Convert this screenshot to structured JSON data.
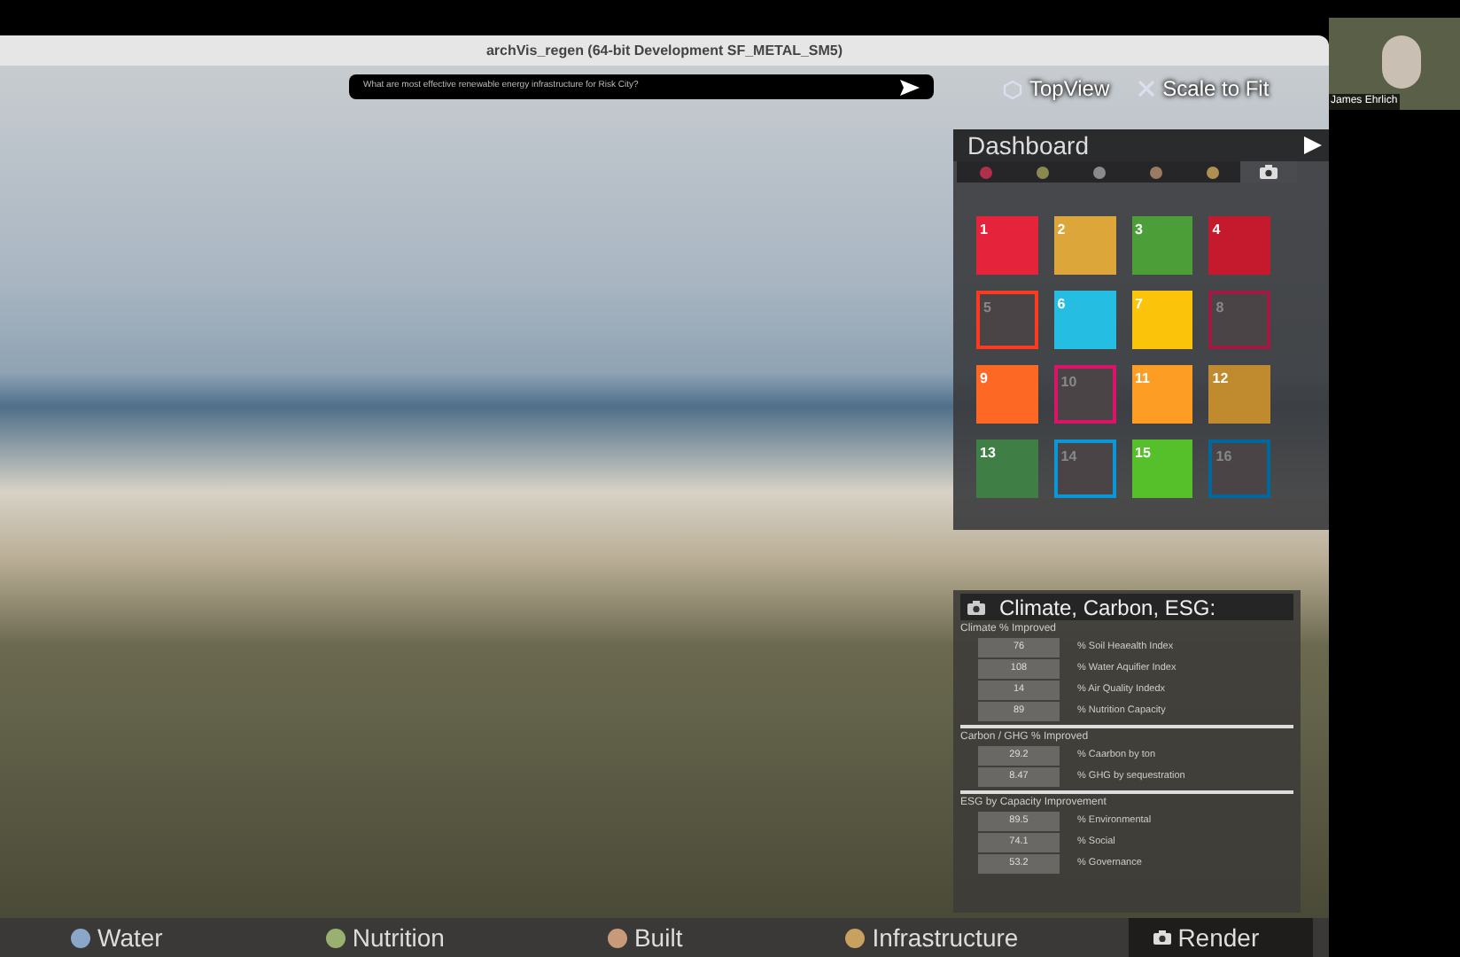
{
  "window": {
    "title": "archVis_regen (64-bit Development SF_METAL_SM5)"
  },
  "prompt": {
    "value": "What are most effective renewable energy infrastructure for Risk City?"
  },
  "view_buttons": [
    {
      "label": "TopView"
    },
    {
      "label": "Scale to Fit"
    }
  ],
  "dashboard": {
    "title": "Dashboard",
    "tabs": [
      {
        "color": "#b0304a",
        "selected": false
      },
      {
        "color": "#8a8a50",
        "selected": false
      },
      {
        "color": "#8a8a8a",
        "selected": false
      },
      {
        "color": "#9a7a60",
        "selected": false
      },
      {
        "color": "#b09050",
        "selected": false
      },
      {
        "color": "#dddddd",
        "selected": true
      }
    ],
    "goals": [
      {
        "number": "1",
        "color": "#e5243b",
        "active": true
      },
      {
        "number": "2",
        "color": "#dda63a",
        "active": true
      },
      {
        "number": "3",
        "color": "#4c9f38",
        "active": true
      },
      {
        "number": "4",
        "color": "#c5192d",
        "active": true
      },
      {
        "number": "5",
        "color": "#ff3a21",
        "active": false
      },
      {
        "number": "6",
        "color": "#26bde2",
        "active": true
      },
      {
        "number": "7",
        "color": "#fcc30b",
        "active": true
      },
      {
        "number": "8",
        "color": "#a21942",
        "active": false
      },
      {
        "number": "9",
        "color": "#fd6925",
        "active": true
      },
      {
        "number": "10",
        "color": "#dd1367",
        "active": false
      },
      {
        "number": "11",
        "color": "#fd9d24",
        "active": true
      },
      {
        "number": "12",
        "color": "#bf8b2e",
        "active": true
      },
      {
        "number": "13",
        "color": "#3f7e44",
        "active": true
      },
      {
        "number": "14",
        "color": "#0a97d9",
        "active": false
      },
      {
        "number": "15",
        "color": "#56c02b",
        "active": true
      },
      {
        "number": "16",
        "color": "#00689d",
        "active": false
      }
    ]
  },
  "climate_panel": {
    "title": "Climate, Carbon, ESG:",
    "sections": [
      {
        "heading": "Climate % Improved",
        "rows": [
          {
            "value": "76",
            "label": "% Soil Heaealth Index"
          },
          {
            "value": "108",
            "label": "% Water Aquifier Index"
          },
          {
            "value": "14",
            "label": "% Air Quality Indedx"
          },
          {
            "value": "89",
            "label": "% Nutrition Capacity"
          }
        ]
      },
      {
        "heading": "Carbon / GHG % Improved",
        "rows": [
          {
            "value": "29.2",
            "label": "% Caarbon by ton"
          },
          {
            "value": "8.47",
            "label": "% GHG by sequestration"
          }
        ]
      },
      {
        "heading": "ESG by Capacity Improvement",
        "rows": [
          {
            "value": "89.5",
            "label": "% Environmental"
          },
          {
            "value": "74.1",
            "label": "% Social"
          },
          {
            "value": "53.2",
            "label": "% Governance"
          }
        ]
      }
    ]
  },
  "bottom_tabs": [
    {
      "label": "Water",
      "kind": "dot",
      "color": "#8aa6c8",
      "selected": false
    },
    {
      "label": "Nutrition",
      "kind": "dot",
      "color": "#9ab070",
      "selected": false
    },
    {
      "label": "Built",
      "kind": "dot",
      "color": "#c89a78",
      "selected": false
    },
    {
      "label": "Infrastructure",
      "kind": "dot",
      "color": "#c8a060",
      "selected": false
    },
    {
      "label": "Render",
      "kind": "camera",
      "color": "#dddddd",
      "selected": true
    }
  ],
  "participant": {
    "name": "James Ehrlich"
  }
}
